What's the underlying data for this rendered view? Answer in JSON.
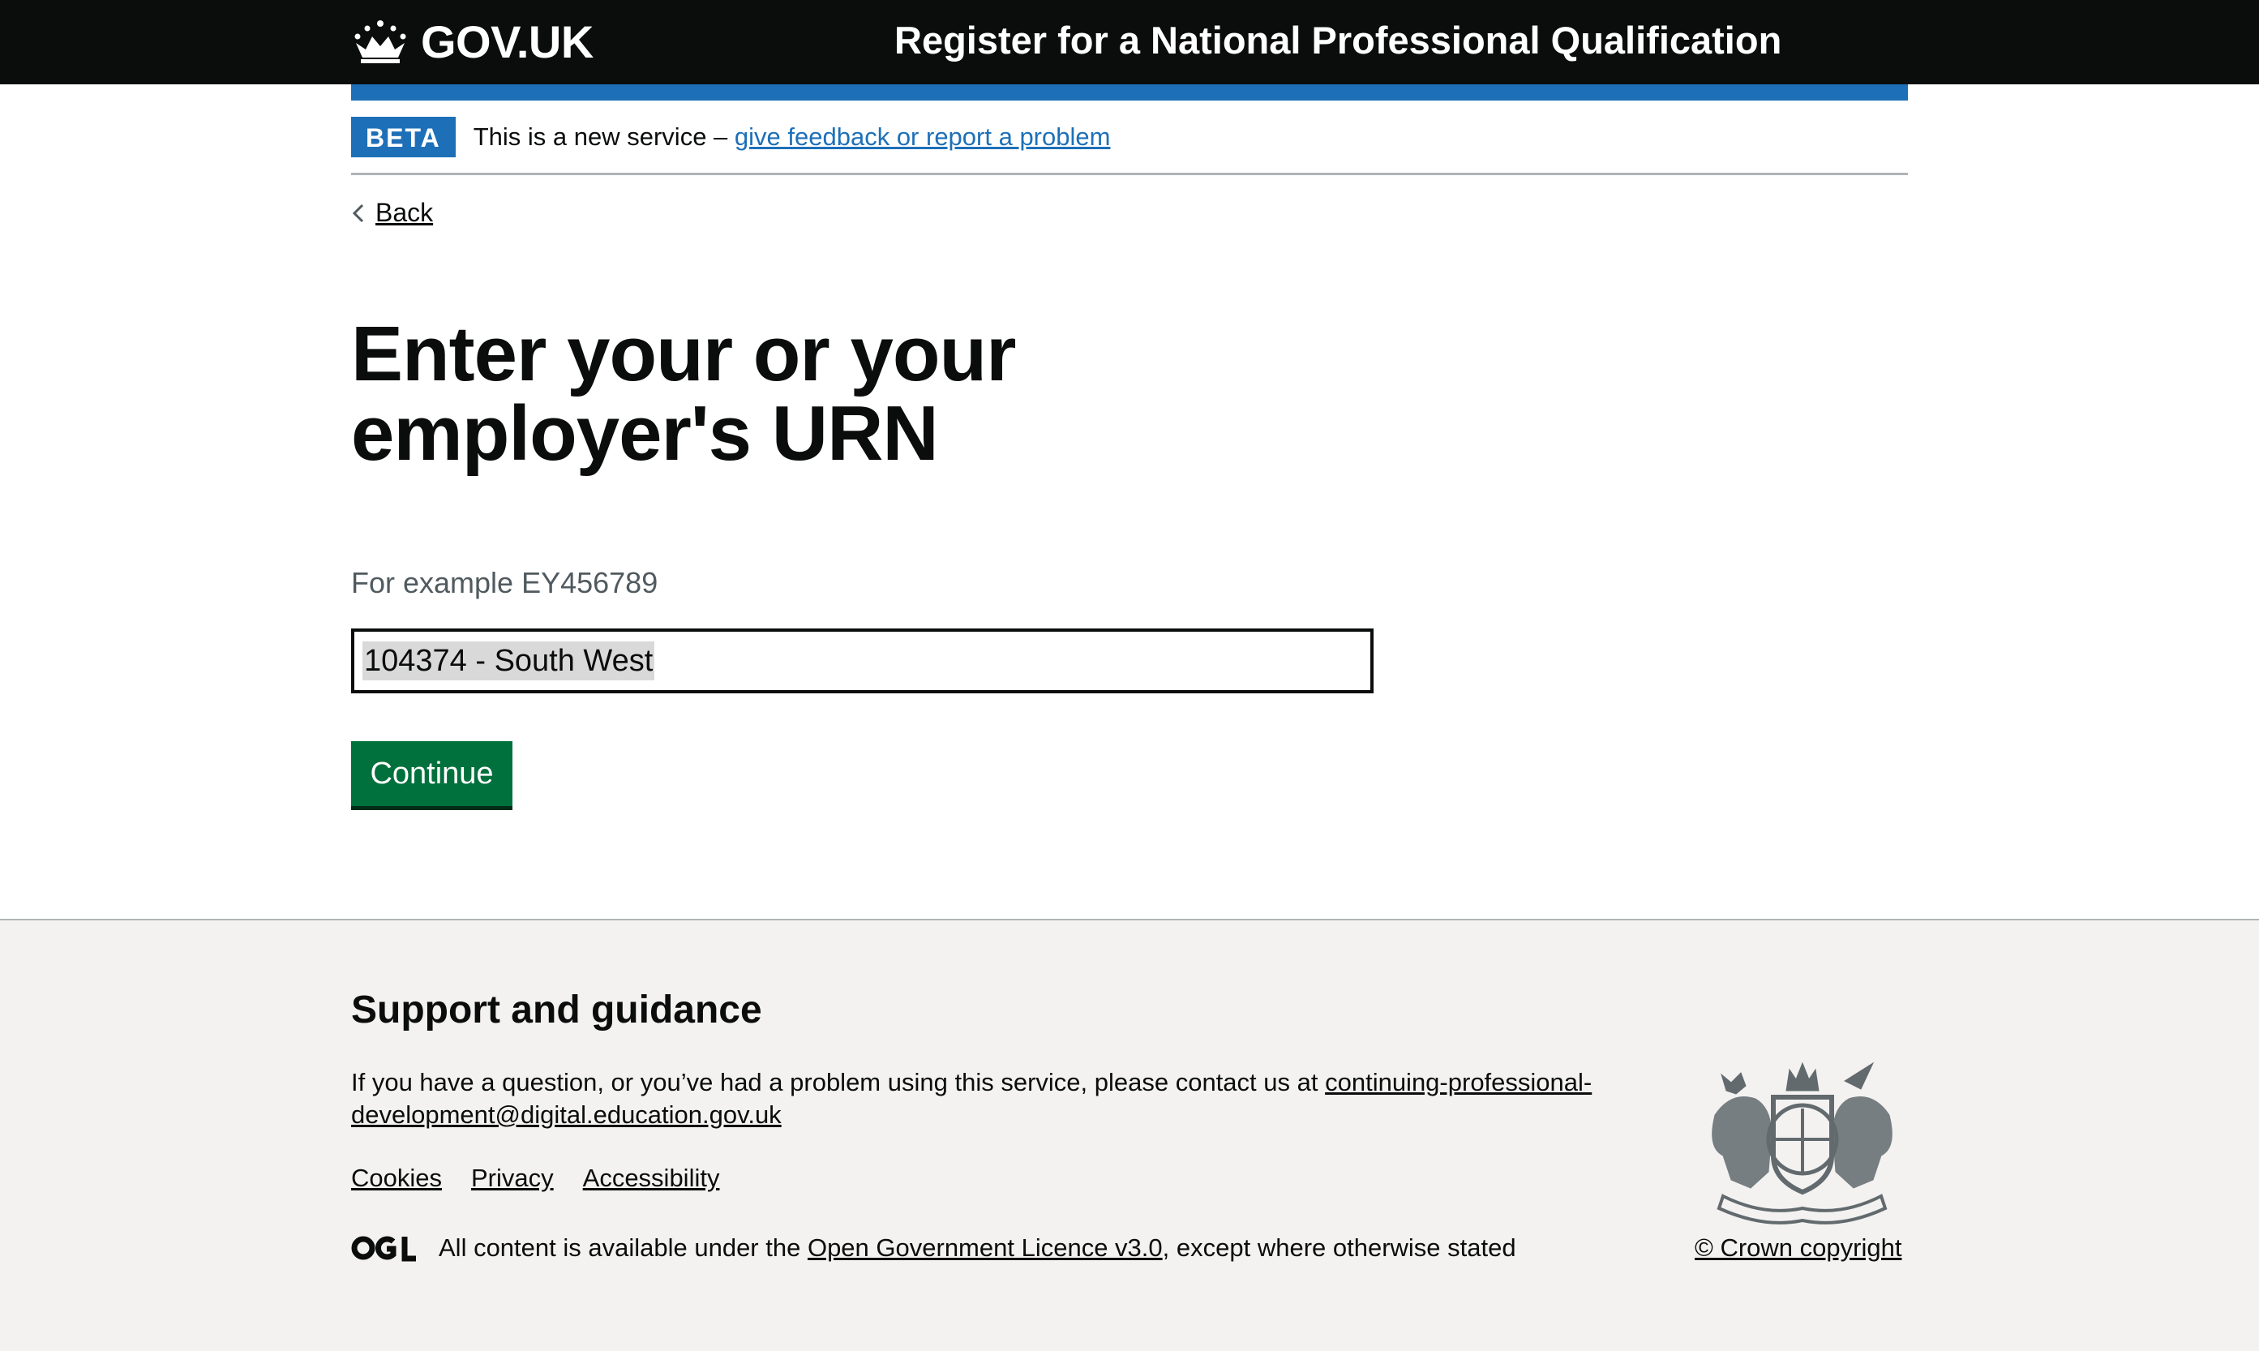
{
  "header": {
    "logo_text": "GOV.UK",
    "service_name": "Register for a National Professional Qualification"
  },
  "phase_banner": {
    "tag": "BETA",
    "text": "This is a new service – ",
    "link": "give feedback or report a problem"
  },
  "back_link": "Back",
  "main": {
    "title": "Enter your or your employer's URN",
    "hint": "For example EY456789",
    "input_value": "104374 - South West",
    "continue_label": "Continue"
  },
  "footer": {
    "heading": "Support and guidance",
    "support_text": "If you have a question, or you’ve had a problem using this service, please contact us at ",
    "support_email": "continuing-professional-development@digital.education.gov.uk",
    "links": [
      "Cookies",
      "Privacy",
      "Accessibility"
    ],
    "licence_prefix": "All content is available under the ",
    "licence_link": "Open Government Licence v3.0",
    "licence_suffix": ", except where otherwise stated",
    "crown_copyright": "© Crown copyright"
  },
  "colors": {
    "header_bg": "#0b0c0c",
    "brand_blue": "#1d70b8",
    "button_green": "#00703c",
    "footer_bg": "#f3f2f1"
  },
  "icons": [
    "crown-icon",
    "chevron-left-icon",
    "ogl-logo-icon",
    "royal-coat-of-arms-icon"
  ]
}
